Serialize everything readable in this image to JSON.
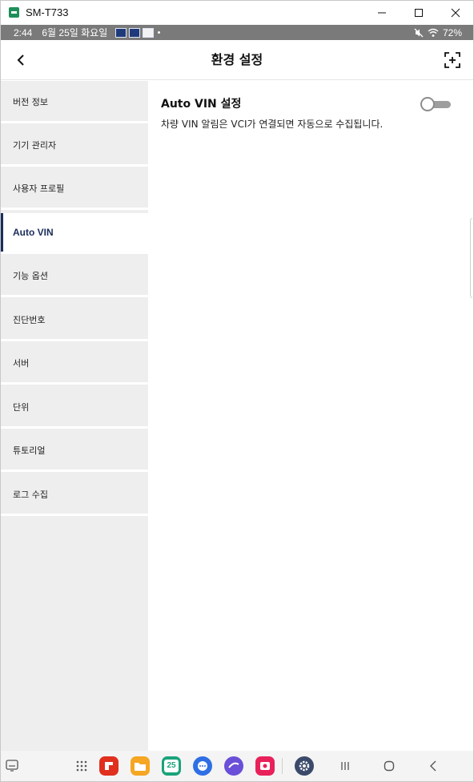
{
  "window": {
    "title": "SM-T733",
    "icons": [
      "app-icon",
      "minimize-icon",
      "maximize-icon",
      "close-icon"
    ]
  },
  "statusbar": {
    "time": "2:44",
    "date": "6월 25일 화요일",
    "battery": "72%",
    "icons": [
      "mute-icon",
      "wifi-icon"
    ]
  },
  "header": {
    "title": "환경 설정",
    "icons": [
      "back-arrow-icon",
      "expand-icon"
    ]
  },
  "sidebar": {
    "items": [
      {
        "label": "버전 정보"
      },
      {
        "label": "기기 관리자"
      },
      {
        "label": "사용자 프로필"
      },
      {
        "label": "Auto VIN",
        "active": true
      },
      {
        "label": "기능 옵션"
      },
      {
        "label": "진단번호"
      },
      {
        "label": "서버"
      },
      {
        "label": "단위"
      },
      {
        "label": "튜토리얼"
      },
      {
        "label": "로그 수집"
      }
    ]
  },
  "content": {
    "title": "Auto VIN 설정",
    "description": "차량 VIN 알림은 VCI가 연결되면 자동으로 수집됩니다.",
    "toggle_on": false
  },
  "taskbar": {
    "calendar_day": "25",
    "icons": [
      "keyboard-icon",
      "app-grid-icon",
      "flipboard-icon",
      "files-icon",
      "calendar-icon",
      "messages-icon",
      "internet-icon",
      "camera-icon",
      "settings-icon",
      "recents-icon",
      "home-icon",
      "back-icon"
    ]
  },
  "colors": {
    "accent": "#1a2d5a",
    "sidebar_bg": "#eeeeee",
    "statusbar_bg": "#7a7a7a"
  }
}
